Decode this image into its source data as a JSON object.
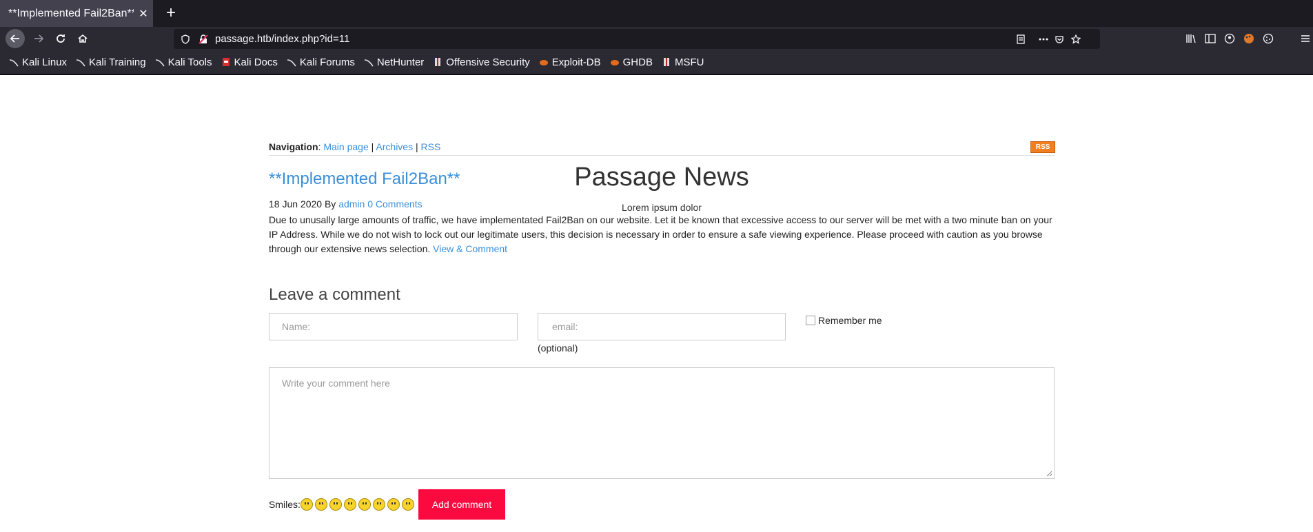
{
  "browser": {
    "tab_title": "**Implemented Fail2Ban**",
    "tab_close": "✕",
    "new_tab": "+",
    "url": "passage.htb/index.php?id=11",
    "bookmarks": [
      "Kali Linux",
      "Kali Training",
      "Kali Tools",
      "Kali Docs",
      "Kali Forums",
      "NetHunter",
      "Offensive Security",
      "Exploit-DB",
      "GHDB",
      "MSFU"
    ]
  },
  "site": {
    "title": "Passage News",
    "subtitle": "Lorem ipsum dolor",
    "nav_label": "Navigation",
    "nav_links": [
      "Main page",
      "Archives",
      "RSS"
    ],
    "rss_badge": "RSS"
  },
  "post": {
    "title": "**Implemented Fail2Ban**",
    "date": "18 Jun 2020",
    "by": "By",
    "author": "admin",
    "comments": "0 Comments",
    "body": "Due to unusally large amounts of traffic, we have implementated Fail2Ban on our website. Let it be known that excessive access to our server will be met with a two minute ban on your IP Address. While we do not wish to lock out our legitimate users, this decision is necessary in order to ensure a safe viewing experience. Please proceed with caution as you browse through our extensive news selection.",
    "view_link": "View & Comment"
  },
  "comment_form": {
    "heading": "Leave a comment",
    "name_placeholder": "Name:",
    "email_placeholder": "email:",
    "email_note": "(optional)",
    "remember": "Remember me",
    "text_placeholder": "Write your comment here",
    "smiles_label": "Smiles:",
    "submit": "Add comment"
  },
  "colors": {
    "link": "#3a8fd9",
    "button": "#fb0a3f",
    "rss": "#f57f1e"
  }
}
